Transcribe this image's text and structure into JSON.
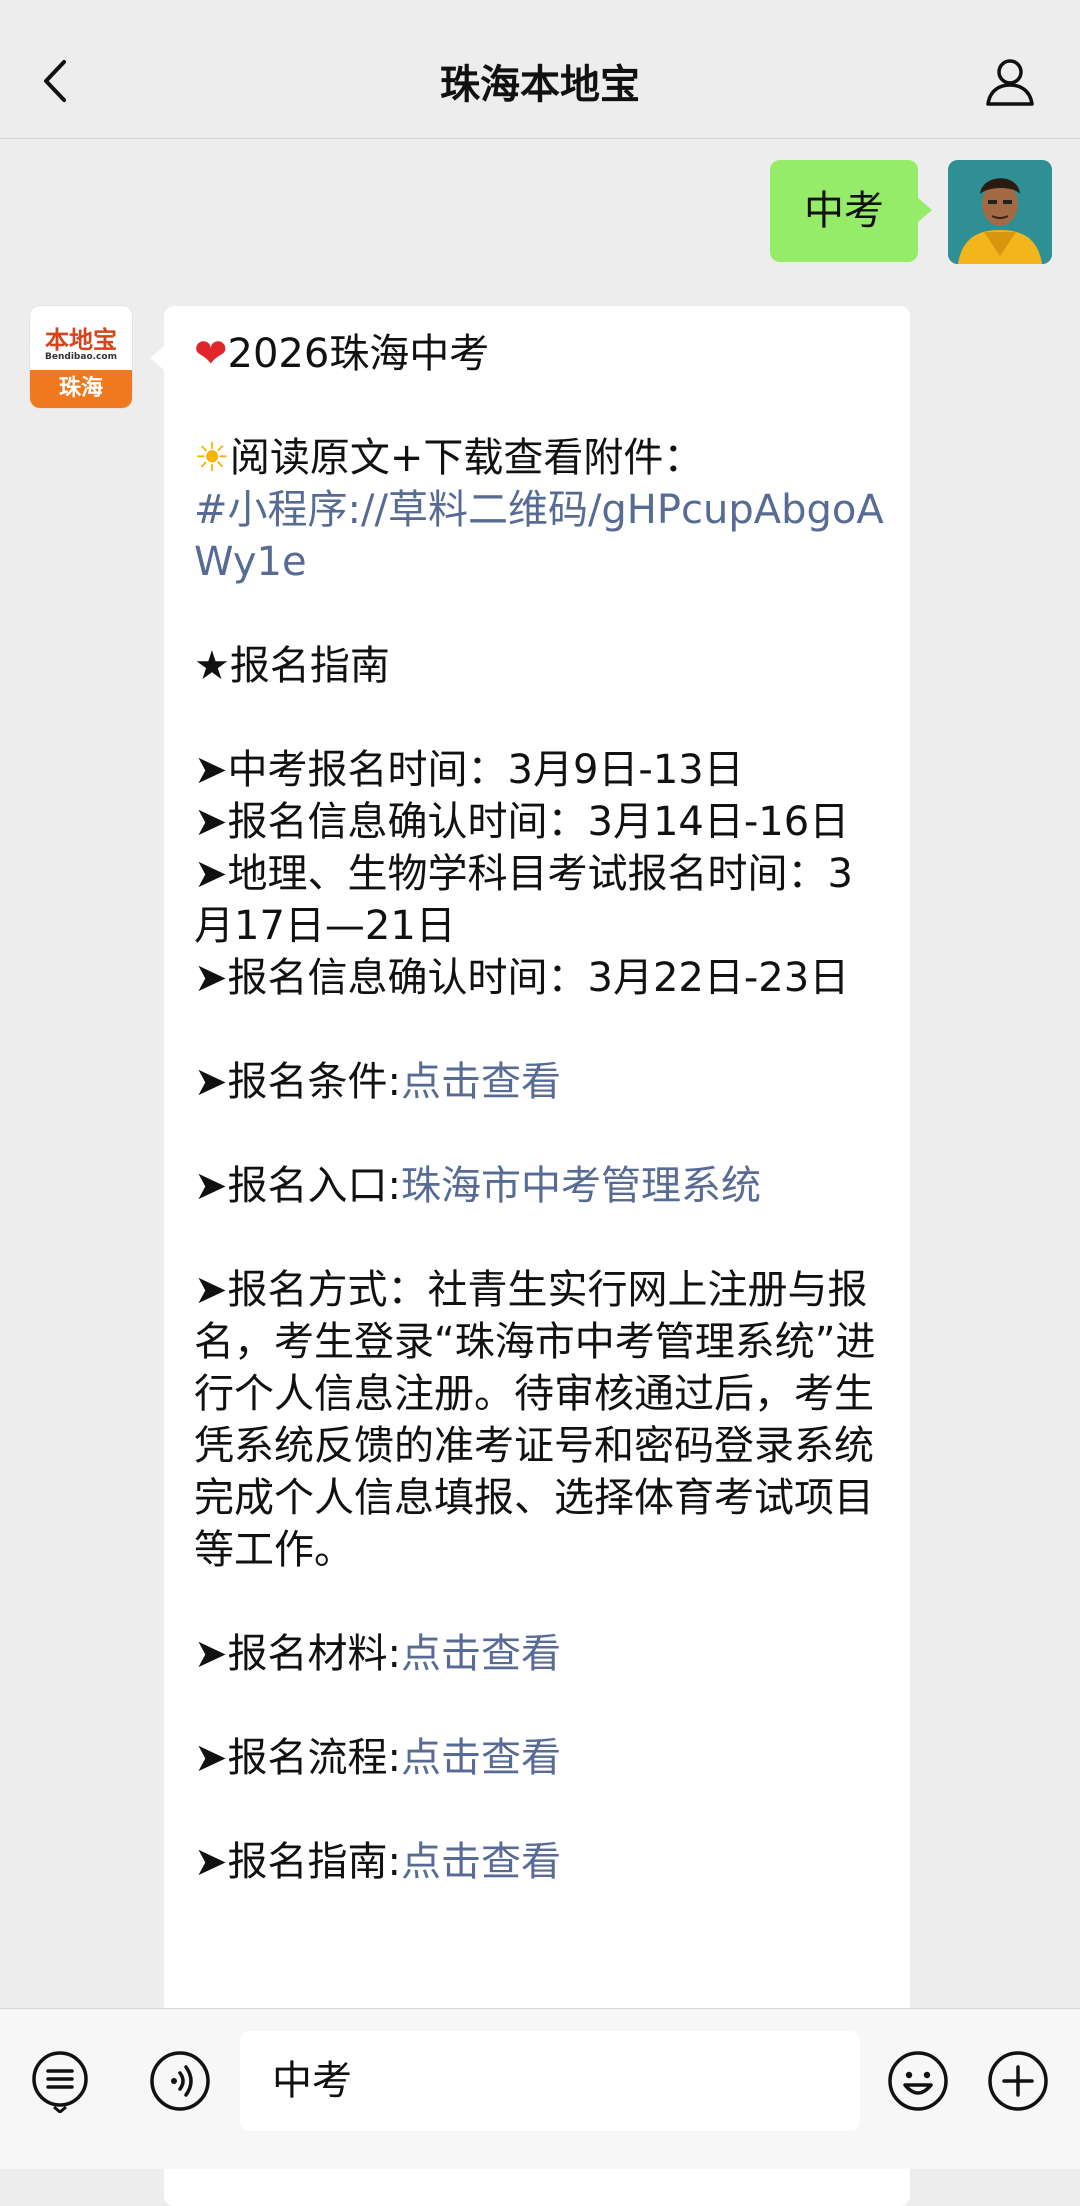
{
  "header": {
    "title": "珠海本地宝"
  },
  "outgoing": {
    "text": "中考"
  },
  "bot_avatar": {
    "logo_top": "本地宝",
    "logo_sub": "Bendibao.com",
    "logo_bottom": "珠海"
  },
  "message": {
    "title": "2026珠海中考",
    "read_label": "阅读原文+下载查看附件：",
    "link_text": "#小程序://草料二维码/gHPcupAbgoAWy1e",
    "section": "★报名指南",
    "lines": [
      "➤中考报名时间：3月9日-13日",
      "➤报名信息确认时间：3月14日-16日",
      "➤地理、生物学科目考试报名时间：3月17日—21日",
      "➤报名信息确认时间：3月22日-23日"
    ],
    "condition_label": "➤报名条件:",
    "condition_link": "点击查看",
    "entry_label": "➤报名入口:",
    "entry_link": "珠海市中考管理系统",
    "method_text": "➤报名方式：社青生实行网上注册与报名，考生登录“珠海市中考管理系统”进行个人信息注册。待审核通过后，考生凭系统反馈的准考证号和密码登录系统完成个人信息填报、选择体育考试项目等工作。",
    "materials_label": "➤报名材料:",
    "materials_link": "点击查看",
    "process_label": "➤报名流程:",
    "process_link": "点击查看",
    "guide_label": "➤报名指南:",
    "guide_link": "点击查看"
  },
  "input": {
    "value": "中考"
  }
}
